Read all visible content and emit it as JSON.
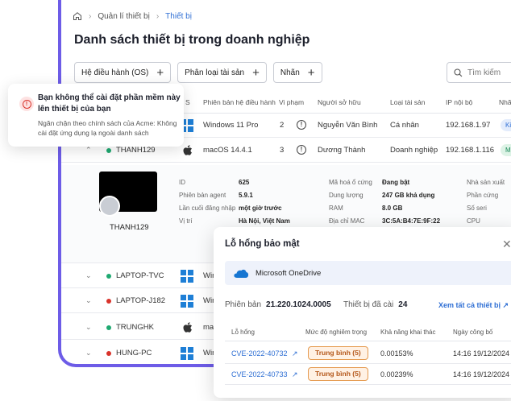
{
  "breadcrumb": {
    "parent": "Quản lí thiết bị",
    "current": "Thiết bị"
  },
  "page_title": "Danh sách thiết bị trong doanh nghiệp",
  "filters": [
    "Hệ điều hành (OS)",
    "Phân loại tài sản",
    "Nhãn"
  ],
  "search": {
    "placeholder": "Tìm kiếm"
  },
  "table": {
    "headers": [
      "S",
      "Phiên bản hệ điều hành",
      "Vi phạm",
      "Người sở hữu",
      "Loại tài sản",
      "IP nội bộ",
      "Nhãn"
    ],
    "rows": [
      {
        "name": "",
        "os": "Windows 11 Pro",
        "violations": "2",
        "owner": "Nguyễn Văn Bình",
        "type": "Cá nhân",
        "ip": "192.168.1.97",
        "tag": "Kin"
      },
      {
        "name": "THANH129",
        "os": "macOS 14.4.1",
        "violations": "3",
        "owner": "Dương Thành",
        "type": "Doanh nghiệp",
        "ip": "192.168.1.116",
        "tag": "Ma"
      },
      {
        "name": "LAPTOP-TVC",
        "os": "Win"
      },
      {
        "name": "LAPTOP-J182",
        "os": "Win"
      },
      {
        "name": "TRUNGHK",
        "os": "mac"
      },
      {
        "name": "HUNG-PC",
        "os": "Win"
      }
    ]
  },
  "detail": {
    "device_name": "THANH129",
    "col1": [
      {
        "k": "ID",
        "v": "625"
      },
      {
        "k": "Phiên bản agent",
        "v": "5.9.1"
      },
      {
        "k": "Lần cuối đăng nhập",
        "v": "một giờ trước"
      },
      {
        "k": "Vị trí",
        "v": "Hà Nội, Việt Nam"
      }
    ],
    "col2": [
      {
        "k": "Mã hoá ổ cứng",
        "v": "Đang bật"
      },
      {
        "k": "Dung lượng",
        "v": "247 GB khả dụng"
      },
      {
        "k": "RAM",
        "v": "8.0 GB"
      },
      {
        "k": "Địa chỉ MAC",
        "v": "3C:5A:B4:7E:9F:22"
      }
    ],
    "col3": [
      "Nhà sản xuất",
      "Phần cứng",
      "Số seri",
      "CPU"
    ]
  },
  "toast": {
    "title": "Bạn không thể cài đặt phần mềm này lên thiết bị của bạn",
    "body": "Ngăn chặn theo chính sách của Acme: Không cài đặt ứng dụng lạ ngoài danh sách"
  },
  "panel": {
    "title": "Lỗ hổng bảo mật",
    "app_name": "Microsoft OneDrive",
    "version_label": "Phiên bản",
    "version_value": "21.220.1024.0005",
    "installed_label": "Thiết bị đã cài",
    "installed_value": "24",
    "see_all": "Xem tất cả thiết bị",
    "headers": [
      "Lỗ hổng",
      "Mức độ nghiêm trọng",
      "Khả năng khai thác",
      "Ngày công bố"
    ],
    "rows": [
      {
        "cve": "CVE-2022-40732",
        "severity": "Trung bình (5)",
        "exploit": "0.00153%",
        "date": "14:16 19/12/2024"
      },
      {
        "cve": "CVE-2022-40733",
        "severity": "Trung bình (5)",
        "exploit": "0.00239%",
        "date": "14:16 19/12/2024"
      }
    ]
  },
  "colors": {
    "accent": "#6d5ce7",
    "link": "#2f6fd4",
    "online": "#1fa971",
    "offline": "#d9332b",
    "windows": "#1e7fd6"
  }
}
